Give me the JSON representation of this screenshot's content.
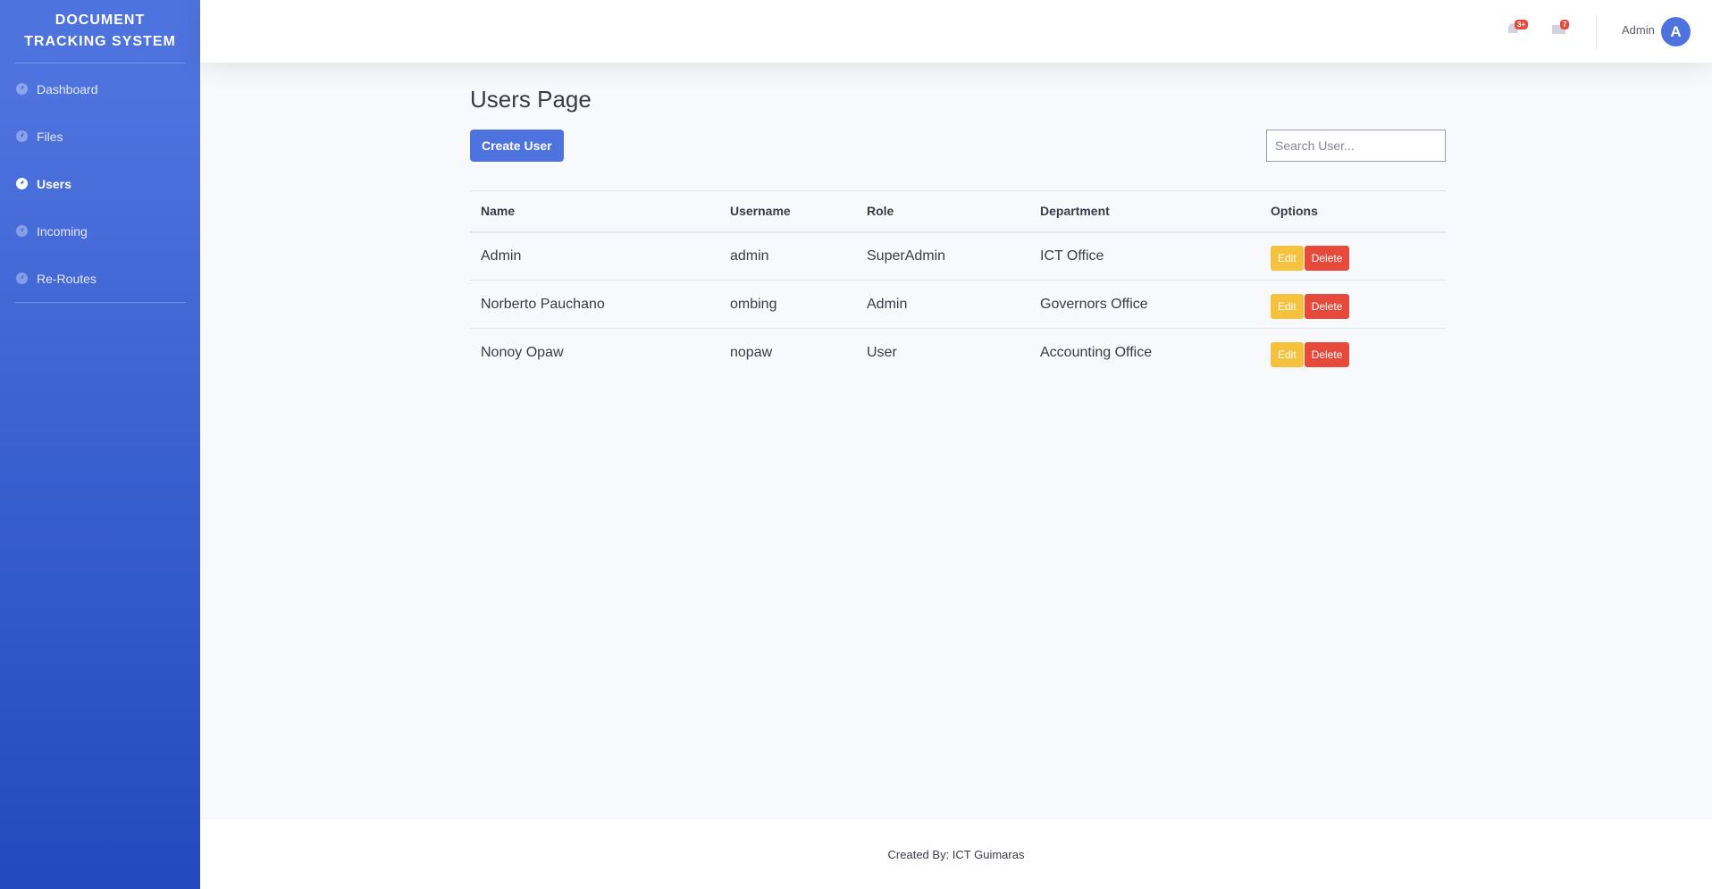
{
  "sidebar": {
    "brand": "DOCUMENT TRACKING SYSTEM",
    "items": [
      {
        "label": "Dashboard",
        "icon": "dashboard-icon",
        "active": false
      },
      {
        "label": "Files",
        "icon": "dashboard-icon",
        "active": false
      },
      {
        "label": "Users",
        "icon": "dashboard-icon",
        "active": true
      },
      {
        "label": "Incoming",
        "icon": "dashboard-icon",
        "active": false
      },
      {
        "label": "Re-Routes",
        "icon": "dashboard-icon",
        "active": false
      }
    ]
  },
  "topbar": {
    "alerts_badge": "3+",
    "messages_badge": "7",
    "user_name": "Admin",
    "avatar_initial": "A"
  },
  "main": {
    "page_title": "Users Page",
    "create_button": "Create User",
    "search_placeholder": "Search User...",
    "table": {
      "headers": [
        "Name",
        "Username",
        "Role",
        "Department",
        "Options"
      ],
      "rows": [
        {
          "name": "Admin",
          "username": "admin",
          "role": "SuperAdmin",
          "department": "ICT Office"
        },
        {
          "name": "Norberto Pauchano",
          "username": "ombing",
          "role": "Admin",
          "department": "Governors Office"
        },
        {
          "name": "Nonoy Opaw",
          "username": "nopaw",
          "role": "User",
          "department": "Accounting Office"
        }
      ],
      "edit_label": "Edit",
      "delete_label": "Delete"
    }
  },
  "footer": {
    "text": "Created By: ICT Guimaras"
  },
  "colors": {
    "primary": "#4e73df",
    "warning": "#f6c23e",
    "danger": "#e74a3b"
  }
}
